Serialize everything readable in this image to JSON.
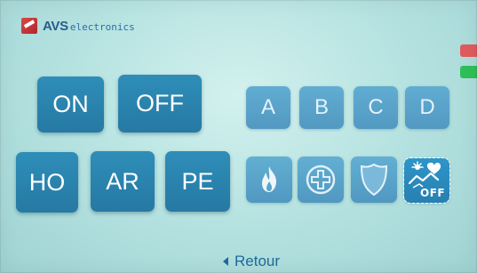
{
  "brand": {
    "logo_text": "AVS",
    "name_main": "AVS",
    "name_sub": "electronics"
  },
  "status": {
    "alarm_color": "#e05b5e",
    "ok_color": "#2fbf59"
  },
  "mode_buttons": {
    "on": "ON",
    "off": "OFF",
    "ho": "HO",
    "ar": "AR",
    "pe": "PE"
  },
  "zone_buttons": {
    "a": "A",
    "b": "B",
    "c": "C",
    "d": "D"
  },
  "function_buttons": {
    "fire": {
      "icon": "flame-icon"
    },
    "medical": {
      "icon": "medical-cross-icon"
    },
    "shield": {
      "icon": "shield-icon"
    },
    "climate": {
      "icon": "climate-off-icon",
      "label": "OFF",
      "selected": true
    }
  },
  "footer": {
    "back_label": "Retour",
    "back_icon": "back-arrow-icon"
  }
}
